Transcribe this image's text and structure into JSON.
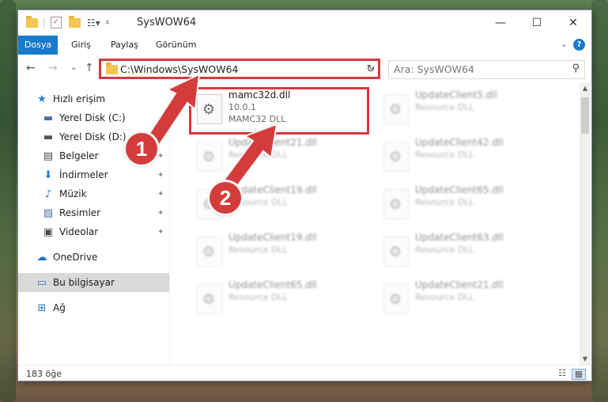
{
  "window": {
    "title": "SysWOW64",
    "minimize_glyph": "—",
    "maximize_glyph": "☐",
    "close_glyph": "✕"
  },
  "ribbon": {
    "tabs": [
      {
        "label": "Dosya",
        "active": true
      },
      {
        "label": "Giriş",
        "active": false
      },
      {
        "label": "Paylaş",
        "active": false
      },
      {
        "label": "Görünüm",
        "active": false
      }
    ],
    "help_glyph": "?",
    "expand_glyph": "⌄"
  },
  "nav": {
    "back_glyph": "←",
    "forward_glyph": "→",
    "recent_glyph": "⌄",
    "up_glyph": "↑",
    "address": "C:\\Windows\\SysWOW64",
    "address_dropdown_glyph": "⌄",
    "refresh_glyph": "↻",
    "search_placeholder": "Ara: SysWOW64",
    "search_glyph": "⚲"
  },
  "sidebar": {
    "items": [
      {
        "label": "Hızlı erişim",
        "icon": "star-icon",
        "glyph": "★",
        "color": "#2a7ad1",
        "pinned": false,
        "selected": false
      },
      {
        "label": "Yerel Disk (C:)",
        "icon": "drive-icon",
        "glyph": "▬",
        "color": "#4a6fa5",
        "pinned": true,
        "selected": false
      },
      {
        "label": "Yerel Disk (D:)",
        "icon": "drive-icon",
        "glyph": "▬",
        "color": "#555555",
        "pinned": true,
        "selected": false
      },
      {
        "label": "Belgeler",
        "icon": "documents-icon",
        "glyph": "▤",
        "color": "#4a4a4a",
        "pinned": true,
        "selected": false
      },
      {
        "label": "İndirmeler",
        "icon": "downloads-icon",
        "glyph": "⬇",
        "color": "#2a7ad1",
        "pinned": true,
        "selected": false
      },
      {
        "label": "Müzik",
        "icon": "music-icon",
        "glyph": "♪",
        "color": "#2a7ad1",
        "pinned": true,
        "selected": false
      },
      {
        "label": "Resimler",
        "icon": "pictures-icon",
        "glyph": "▧",
        "color": "#4a6fa5",
        "pinned": true,
        "selected": false
      },
      {
        "label": "Videolar",
        "icon": "videos-icon",
        "glyph": "▣",
        "color": "#4a4a4a",
        "pinned": true,
        "selected": false
      },
      {
        "label": "OneDrive",
        "icon": "cloud-icon",
        "glyph": "☁",
        "color": "#1e6fc6",
        "pinned": false,
        "selected": false
      },
      {
        "label": "Bu bilgisayar",
        "icon": "computer-icon",
        "glyph": "▭",
        "color": "#2a7ad1",
        "pinned": false,
        "selected": true
      },
      {
        "label": "Ağ",
        "icon": "network-icon",
        "glyph": "⊞",
        "color": "#2a7ad1",
        "pinned": false,
        "selected": false
      }
    ],
    "pin_glyph": "✦"
  },
  "files": [
    {
      "name": "mamc32d.dll",
      "line2": "10.0.1",
      "line3": "MAMC32 DLL",
      "focused": true
    },
    {
      "name": "UpdateClient5.dll",
      "line2": "Resource DLL",
      "focused": false
    },
    {
      "name": "UpdateClient21.dll",
      "line2": "Resource DLL",
      "focused": false
    },
    {
      "name": "UpdateClient42.dll",
      "line2": "Resource DLL",
      "focused": false
    },
    {
      "name": "UpdateClient19.dll",
      "line2": "Resource DLL",
      "focused": false
    },
    {
      "name": "UpdateClient65.dll",
      "line2": "Resource DLL",
      "focused": false
    },
    {
      "name": "UpdateClient19.dll",
      "line2": "Resource DLL",
      "focused": false
    },
    {
      "name": "UpdateClient63.dll",
      "line2": "Resource DLL",
      "focused": false
    },
    {
      "name": "UpdateClient65.dll",
      "line2": "Resource DLL",
      "focused": false
    },
    {
      "name": "UpdateClient21.dll",
      "line2": "Resource DLL",
      "focused": false
    }
  ],
  "file_gear_glyph": "⚙",
  "status": {
    "item_count": "183 öğe",
    "details_view_glyph": "☷",
    "tiles_view_glyph": "▦"
  },
  "scroll": {
    "up_glyph": "▲",
    "down_glyph": "▼"
  },
  "annotations": {
    "marker1": "1",
    "marker2": "2",
    "highlight_color": "#d9383f"
  }
}
